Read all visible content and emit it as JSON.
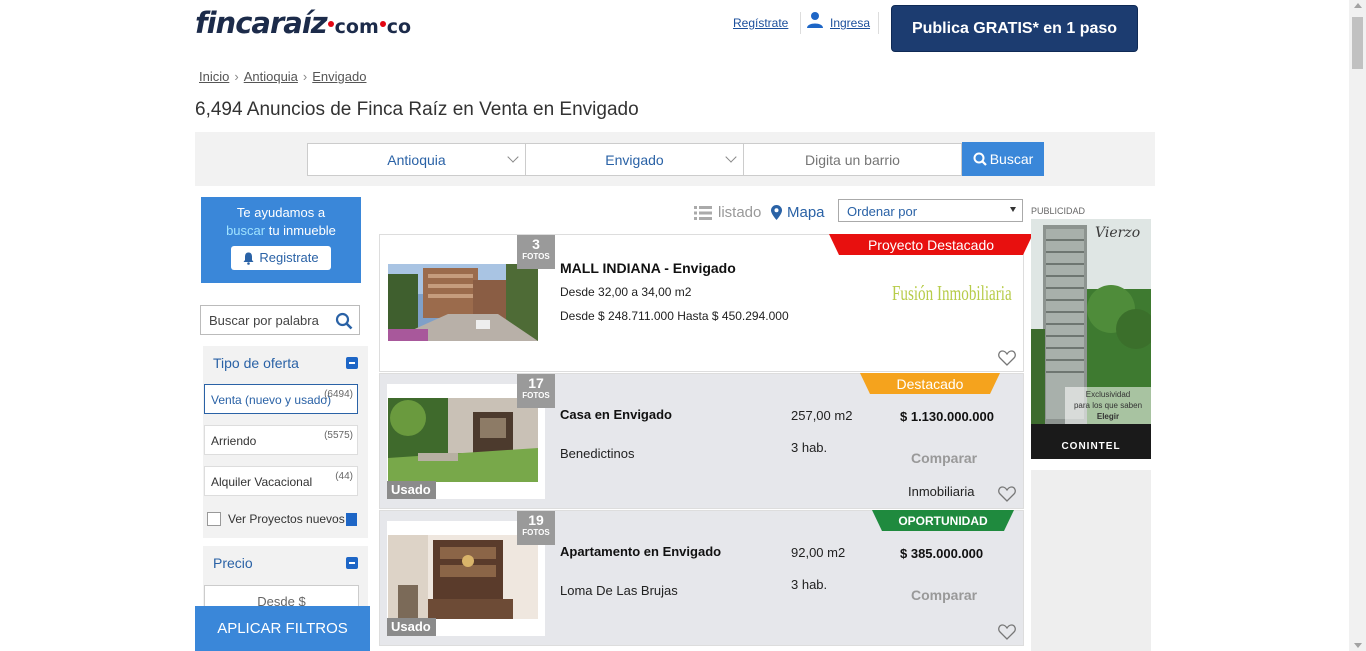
{
  "header": {
    "logo_main": "fincaraíz",
    "logo_com": "com",
    "logo_co": "co",
    "register_link": "Regístrate",
    "login_link": "Ingresa",
    "publish_button": "Publica GRATIS* en 1 paso"
  },
  "breadcrumb": [
    "Inicio",
    "Antioquia",
    "Envigado"
  ],
  "page_title": "6,494 Anuncios de Finca Raíz en Venta en Envigado",
  "search": {
    "department": "Antioquia",
    "city": "Envigado",
    "barrio_placeholder": "Digita un barrio",
    "button": "Buscar"
  },
  "sidebar": {
    "help_line1": "Te ayudamos a",
    "help_highlight": "buscar",
    "help_line2": " tu inmueble",
    "register_button": "Registrate",
    "keyword_placeholder": "Buscar por palabra",
    "offer_title": "Tipo de oferta",
    "offers": [
      {
        "label": "Venta (nuevo y usado)",
        "count": "(6494)"
      },
      {
        "label": "Arriendo",
        "count": "(5575)"
      },
      {
        "label": "Alquiler Vacacional",
        "count": "(44)"
      }
    ],
    "projects_label": "Ver Proyectos nuevos",
    "price_title": "Precio",
    "price_from": "Desde $",
    "apply_button": "APLICAR FILTROS"
  },
  "toolbar": {
    "list_view": "listado",
    "map_view": "Mapa",
    "order_label": "Ordenar por"
  },
  "listings": [
    {
      "photos": "3",
      "photos_label": "FOTOS",
      "ribbon": "Proyecto Destacado",
      "title": "MALL INDIANA - Envigado",
      "area": "Desde 32,00 a 34,00 m2",
      "price_range": "Desde $ 248.711.000 Hasta $ 450.294.000",
      "agency": "Fusión Inmobiliaria"
    },
    {
      "photos": "17",
      "photos_label": "FOTOS",
      "ribbon": "Destacado",
      "condition": "Usado",
      "title": "Casa en Envigado",
      "neighborhood": "Benedictinos",
      "area": "257,00 m2",
      "rooms": "3 hab.",
      "price": "$ 1.130.000.000",
      "compare": "Comparar",
      "seller": "Inmobiliaria"
    },
    {
      "photos": "19",
      "photos_label": "FOTOS",
      "ribbon": "OPORTUNIDAD",
      "condition": "Usado",
      "title": "Apartamento en Envigado",
      "neighborhood": "Loma De Las Brujas",
      "area": "92,00 m2",
      "rooms": "3 hab.",
      "price": "$ 385.000.000",
      "compare": "Comparar"
    }
  ],
  "ad": {
    "label": "PUBLICIDAD",
    "brand": "Vierzo",
    "tagline1": "Exclusividad",
    "tagline2": "para los que saben",
    "tagline3": "Elegir",
    "company": "CONINTEL"
  },
  "colors": {
    "primary_blue": "#3a87d9",
    "dark_blue": "#1c3c70",
    "ribbon_red": "#e8100f",
    "ribbon_orange": "#f5a31d",
    "ribbon_green": "#1f8a3e"
  }
}
